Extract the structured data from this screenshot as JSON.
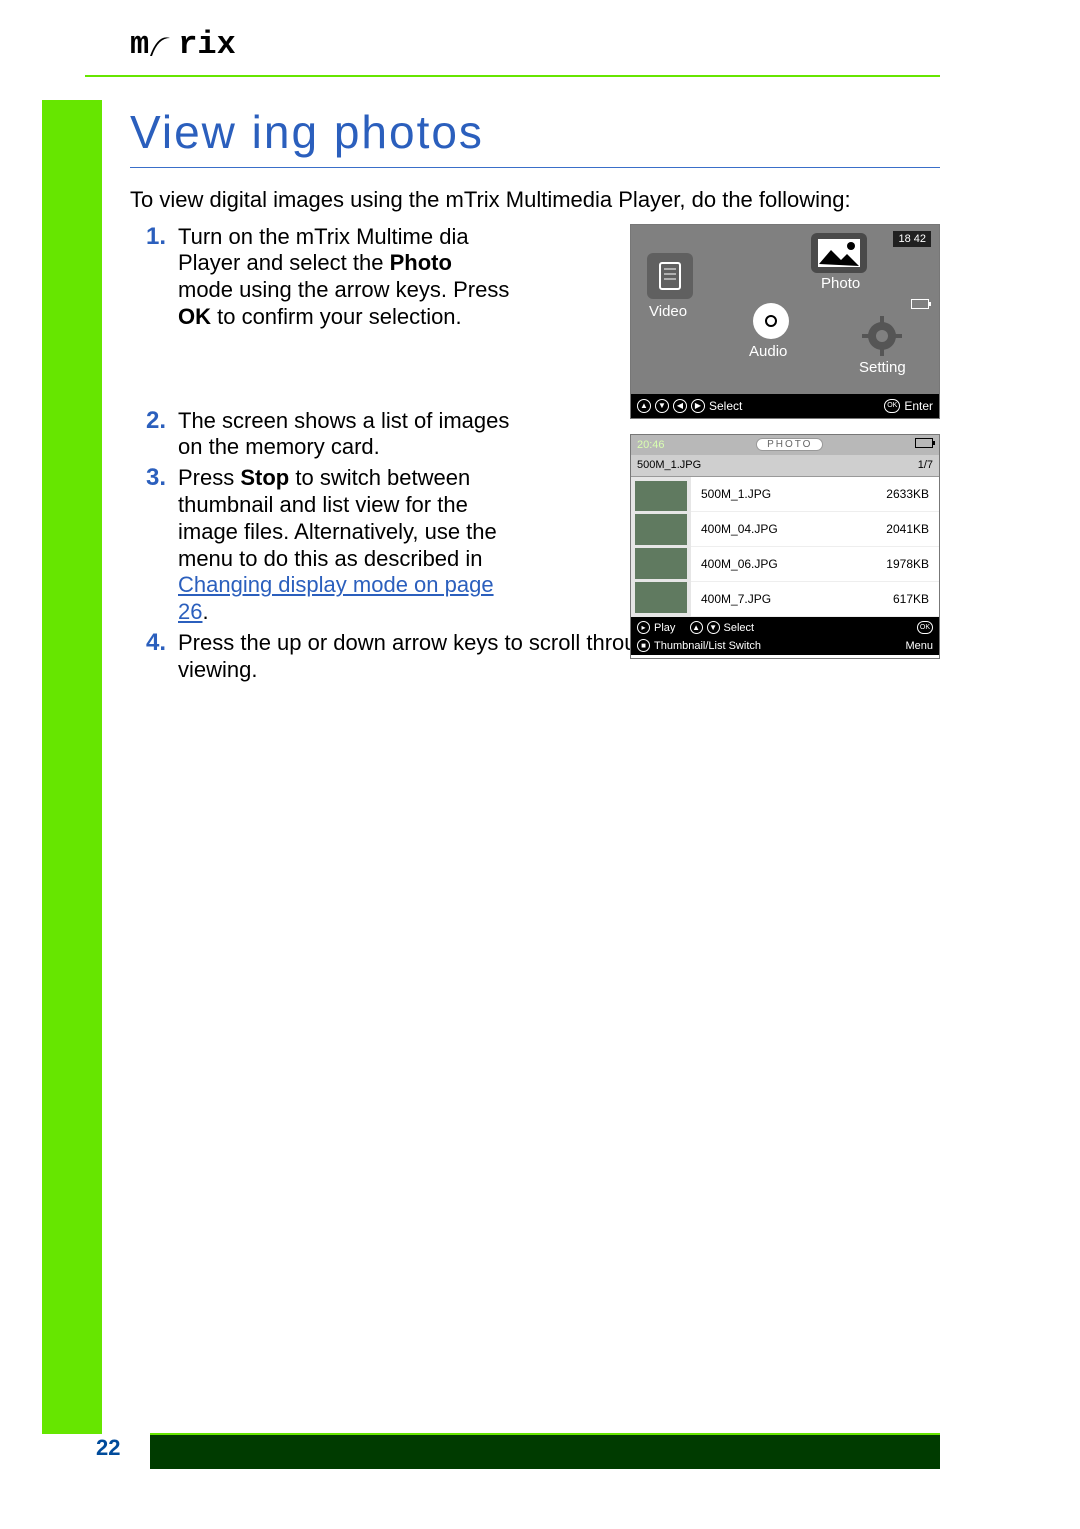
{
  "brand": "mTrix",
  "page_number": "22",
  "title": "View ing photos",
  "intro": "To view digital images using the mTrix Multimedia Player, do the following:",
  "steps": {
    "s1_a": "Turn on the mTrix Multime dia Player and select the ",
    "s1_photo": "Photo",
    "s1_b": " mode using the arrow keys. Press ",
    "s1_ok": "OK",
    "s1_c": " to confirm your selection.",
    "s2": "The screen shows a list of images on the memory card.",
    "s3_a": "Press ",
    "s3_stop": "Stop",
    "s3_b": " to switch between thumbnail and list view for the image files. Alternatively, use the menu to do this as described in ",
    "s3_link": "Changing display mode on page 26",
    "s3_c": ".",
    "s4": "Press the up or down arrow keys to scroll through the files and select a file for viewing."
  },
  "dev1": {
    "time": "18 42",
    "video": "Video",
    "photo": "Photo",
    "audio": "Audio",
    "setting": "Setting",
    "select": "Select",
    "enter": "Enter",
    "ok": "OK"
  },
  "dev2": {
    "clock": "20:46",
    "tag": "PHOTO",
    "current_file": "500M_1.JPG",
    "counter": "1/7",
    "rows": [
      {
        "name": "500M_1.JPG",
        "size": "2633KB"
      },
      {
        "name": "400M_04.JPG",
        "size": "2041KB"
      },
      {
        "name": "400M_06.JPG",
        "size": "1978KB"
      },
      {
        "name": "400M_7.JPG",
        "size": "617KB"
      }
    ],
    "play": "Play",
    "select": "Select",
    "switch": "Thumbnail/List Switch",
    "ok": "OK",
    "menu": "Menu"
  }
}
